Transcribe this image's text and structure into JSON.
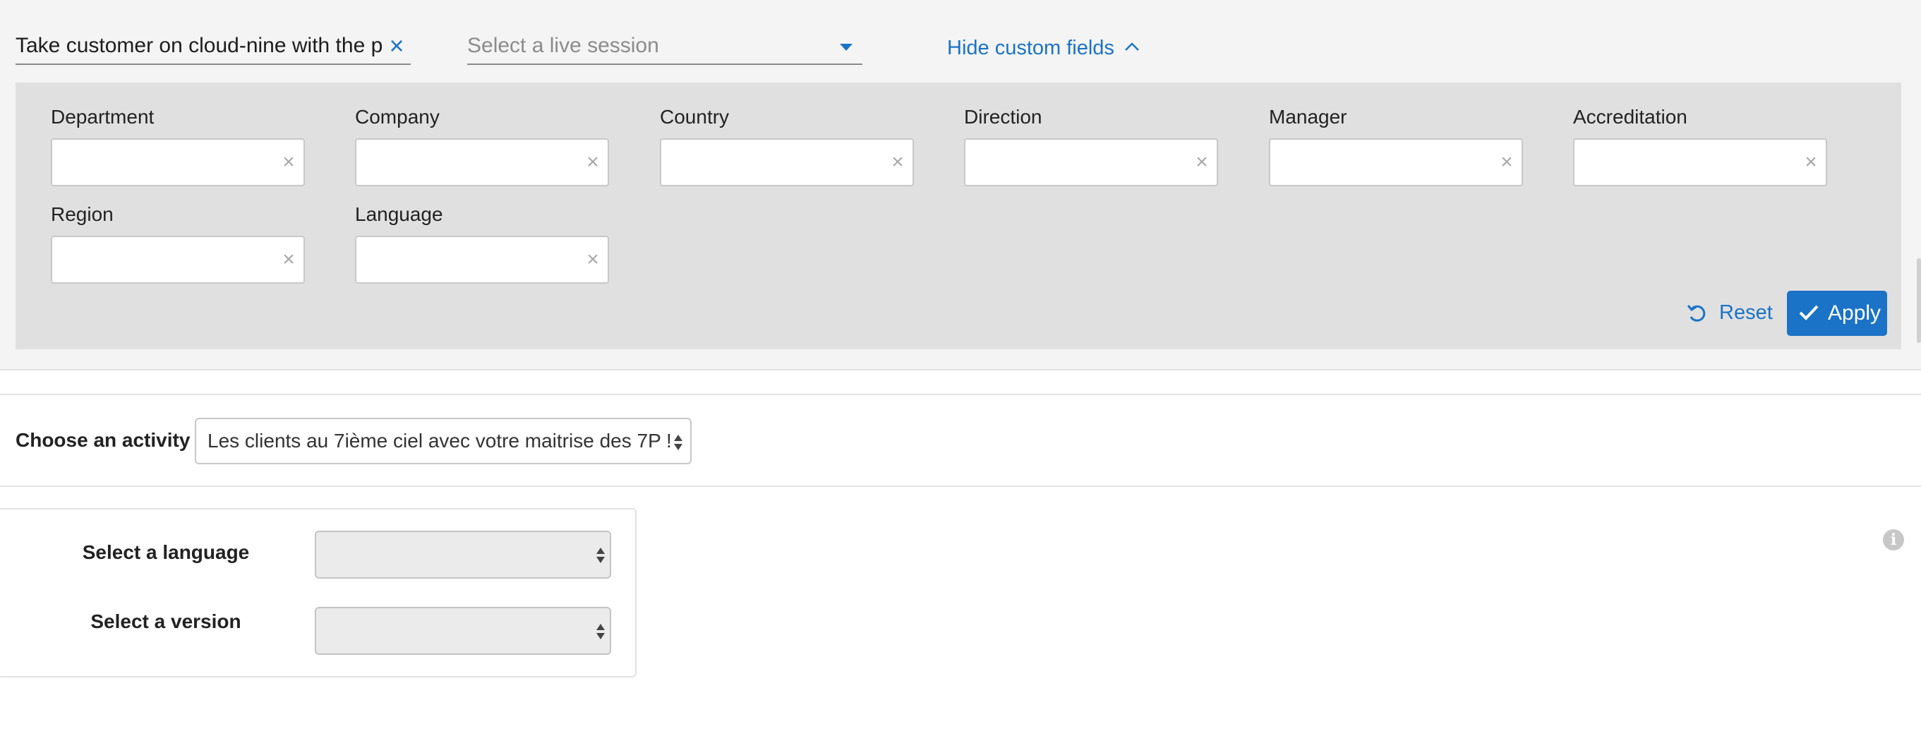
{
  "search": {
    "value": "Take customer on cloud-nine with the p",
    "clear_icon": "close-icon"
  },
  "session": {
    "placeholder": "Select a live session",
    "caret_icon": "caret-down-icon"
  },
  "custom_fields_toggle": {
    "label": "Hide custom fields",
    "icon": "chevron-up-icon"
  },
  "custom_fields": [
    {
      "label": "Department",
      "value": ""
    },
    {
      "label": "Company",
      "value": ""
    },
    {
      "label": "Country",
      "value": ""
    },
    {
      "label": "Direction",
      "value": ""
    },
    {
      "label": "Manager",
      "value": ""
    },
    {
      "label": "Accreditation",
      "value": ""
    },
    {
      "label": "Region",
      "value": ""
    },
    {
      "label": "Language",
      "value": ""
    }
  ],
  "field_clear_glyph": "×",
  "actions": {
    "reset_label": "Reset",
    "apply_label": "Apply"
  },
  "activity": {
    "label": "Choose an activity :",
    "selected": "Les clients au 7ième ciel avec votre maitrise des 7P !"
  },
  "selection_card": {
    "language_label": "Select a language",
    "language_value": "",
    "version_label": "Select a version",
    "version_value": ""
  },
  "info": {
    "glyph": "i"
  },
  "colors": {
    "accent": "#1a73c6",
    "panel_bg": "#e0e0e0",
    "topbar_bg": "#f4f4f4"
  }
}
